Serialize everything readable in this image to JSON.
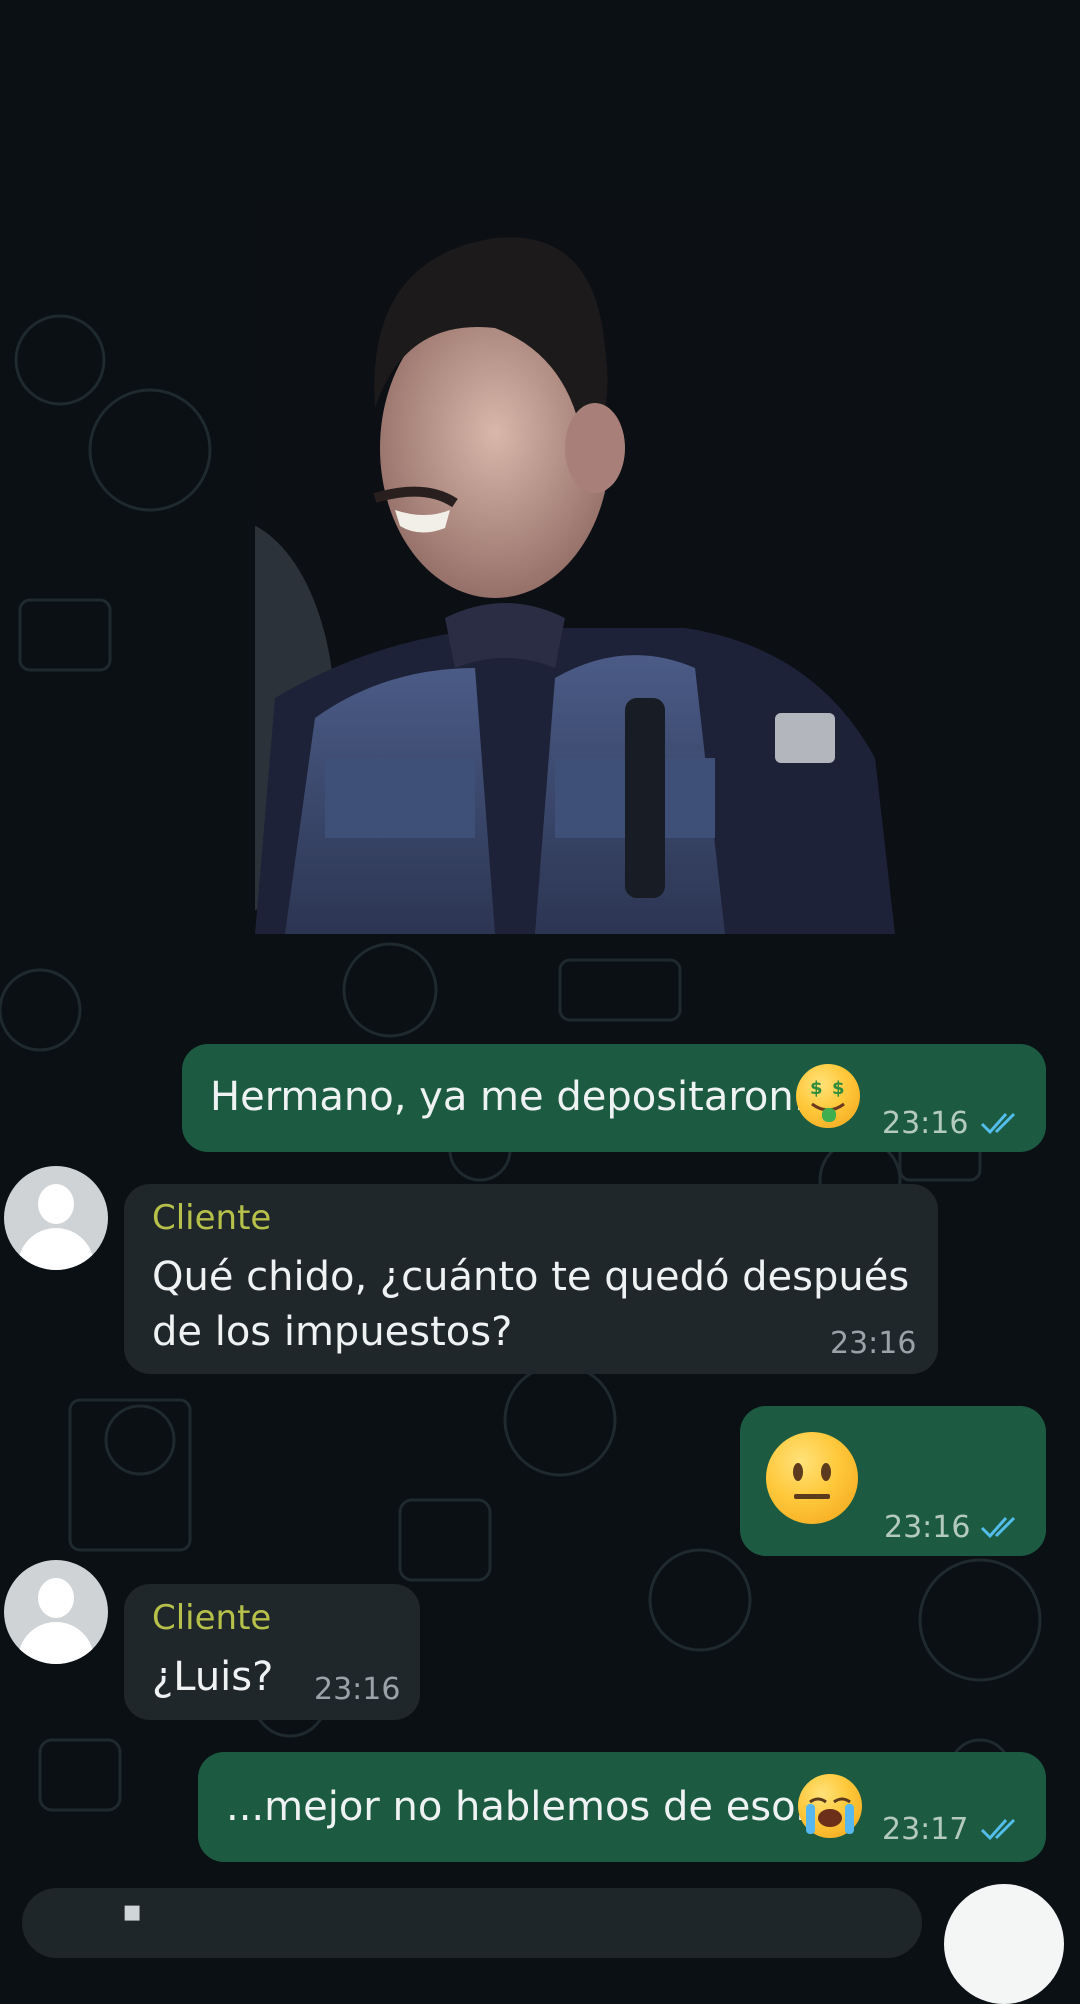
{
  "chat": {
    "messages": [
      {
        "direction": "out",
        "text": "Hermano, ya me depositaron.",
        "emoji": "money-mouth-face",
        "time": "23:16",
        "status": "read"
      },
      {
        "direction": "in",
        "sender": "Cliente",
        "text": "Qué chido, ¿cuánto te quedó después\nde los impuestos?",
        "time": "23:16"
      },
      {
        "direction": "out",
        "text": "",
        "emoji": "neutral-face",
        "time": "23:16",
        "status": "read"
      },
      {
        "direction": "in",
        "sender": "Cliente",
        "text": "¿Luis?",
        "time": "23:16"
      },
      {
        "direction": "out",
        "text": "...mejor no hablemos de eso.",
        "emoji": "loudly-crying-face",
        "time": "23:17",
        "status": "read"
      }
    ]
  },
  "input": {
    "placeholder": "▪"
  },
  "colors": {
    "outgoing_bubble": "#1c5b41",
    "incoming_bubble": "#20272b",
    "sender_name": "#b7c14a",
    "read_ticks": "#53bdeb",
    "background": "#0b1014"
  },
  "icons": [
    "contact-avatar-icon",
    "double-check-icon",
    "mic-icon"
  ]
}
